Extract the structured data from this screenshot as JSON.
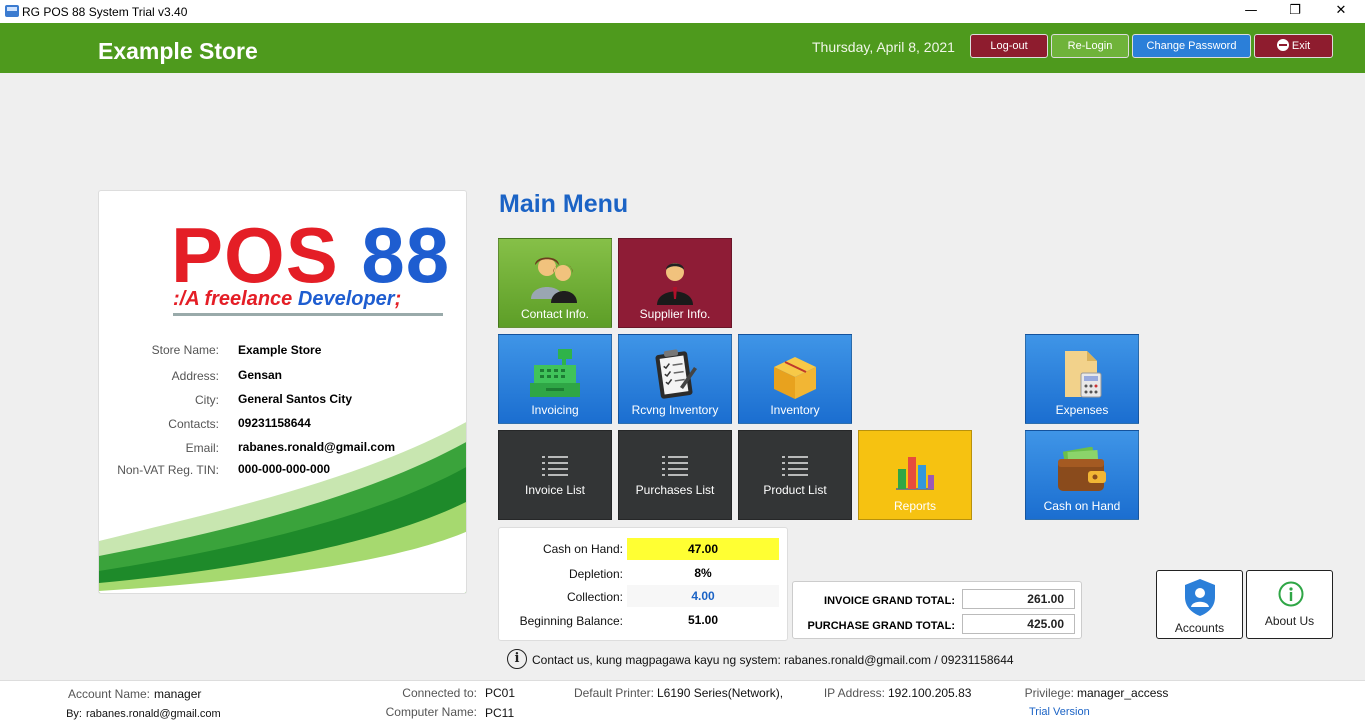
{
  "window": {
    "title": "RG POS 88 System Trial v3.40",
    "minimize": "—",
    "maximize": "❐",
    "close": "✕"
  },
  "header": {
    "store_name": "Example Store",
    "date": "Thursday, April 8, 2021",
    "buttons": {
      "logout": "Log-out",
      "relogin": "Re-Login",
      "change_password": "Change Password",
      "exit": "Exit"
    },
    "colors": {
      "bar": "#4e9a1d",
      "logout": "#8e1c2e",
      "relogin": "#6fb33a",
      "change_password": "#2b7fd9",
      "exit": "#8e1c2e"
    }
  },
  "logo": {
    "part1": "POS ",
    "part2": "88",
    "tag_prefix": ":/A freelance ",
    "tag_word": "Developer",
    "tag_suffix": ";"
  },
  "store_info": [
    {
      "label": "Store Name:",
      "value": "Example Store"
    },
    {
      "label": "Address:",
      "value": "Gensan"
    },
    {
      "label": "City:",
      "value": "General Santos City"
    },
    {
      "label": "Contacts:",
      "value": "09231158644"
    },
    {
      "label": "Email:",
      "value": "rabanes.ronald@gmail.com"
    },
    {
      "label": "Non-VAT Reg. TIN:",
      "value": "000-000-000-000"
    }
  ],
  "main_menu": {
    "title": "Main Menu",
    "tiles": {
      "contact_info": "Contact Info.",
      "supplier_info": "Supplier Info.",
      "invoicing": "Invoicing",
      "rcvng_inventory": "Rcvng Inventory",
      "inventory": "Inventory",
      "expenses": "Expenses",
      "invoice_list": "Invoice List",
      "purchases_list": "Purchases List",
      "product_list": "Product List",
      "reports": "Reports",
      "cash_on_hand": "Cash on Hand"
    }
  },
  "cash_summary": [
    {
      "label": "Cash on Hand:",
      "value": "47.00"
    },
    {
      "label": "Depletion:",
      "value": "8%"
    },
    {
      "label": "Collection:",
      "value": "4.00"
    },
    {
      "label": "Beginning Balance:",
      "value": "51.00"
    }
  ],
  "totals": {
    "invoice_label": "INVOICE GRAND TOTAL:",
    "invoice_value": "261.00",
    "purchase_label": "PURCHASE GRAND TOTAL:",
    "purchase_value": "425.00"
  },
  "side_buttons": {
    "accounts": "Accounts",
    "about": "About Us"
  },
  "contact_line": "Contact us, kung magpagawa kayu ng system: rabanes.ronald@gmail.com / 09231158644",
  "footer": {
    "account_name_label": "Account Name:",
    "account_name": "manager",
    "by_label": "By:",
    "by": "rabanes.ronald@gmail.com",
    "connected_label": "Connected to:",
    "connected": "PC01",
    "computer_label": "Computer Name:",
    "computer": "PC11",
    "printer_label": "Default Printer:",
    "printer": "L6190 Series(Network),",
    "ip_label": "IP Address:",
    "ip": "192.100.205.83",
    "privilege_label": "Privilege:",
    "privilege": "manager_access",
    "trial": "Trial Version"
  }
}
